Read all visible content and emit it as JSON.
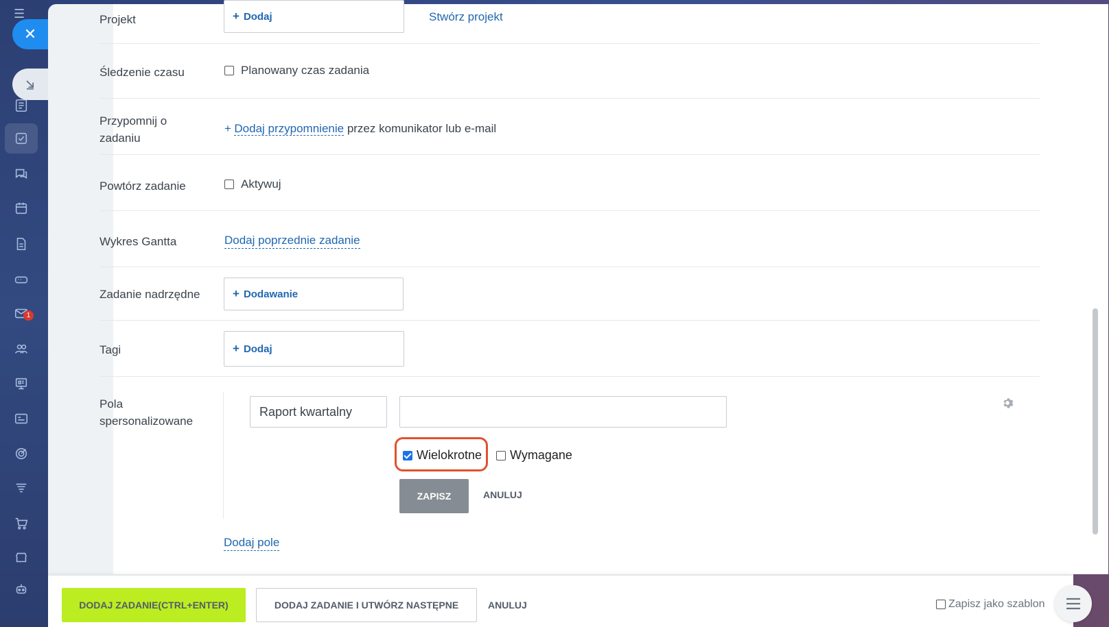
{
  "rows": {
    "project": {
      "label": "Projekt",
      "add": "Dodaj",
      "create_link": "Stwórz projekt"
    },
    "time_tracking": {
      "label": "Śledzenie czasu",
      "checkbox_label": "Planowany czas zadania"
    },
    "remind": {
      "label_line1": "Przypomnij o",
      "label_line2": "zadaniu",
      "plus": "+",
      "link": "Dodaj przypomnienie",
      "suffix": " przez komunikator lub e-mail"
    },
    "repeat": {
      "label": "Powtórz zadanie",
      "checkbox_label": "Aktywuj"
    },
    "gantt": {
      "label": "Wykres Gantta",
      "link": "Dodaj poprzednie zadanie"
    },
    "parent": {
      "label": "Zadanie nadrzędne",
      "add": "Dodawanie"
    },
    "tags": {
      "label": "Tagi",
      "add": "Dodaj"
    },
    "custom": {
      "label_line1": "Pola",
      "label_line2": "spersonalizowane",
      "field_name": "Raport kwartalny",
      "field_value": "",
      "multiple_label": "Wielokrotne",
      "multiple_checked": true,
      "required_label": "Wymagane",
      "required_checked": false,
      "save": "ZAPISZ",
      "cancel": "ANULUJ",
      "add_field": "Dodaj pole"
    }
  },
  "footer": {
    "primary": "DODAJ ZADANIE(CTRL+ENTER)",
    "secondary": "DODAJ ZADANIE I UTWÓRZ NASTĘPNE",
    "cancel": "ANULUJ",
    "template": "Zapisz jako szablon"
  },
  "sidebar": {
    "badge": "1"
  },
  "colors": {
    "accent": "#2067b0",
    "primary_button": "#bbed21",
    "highlight": "#e0522e"
  }
}
